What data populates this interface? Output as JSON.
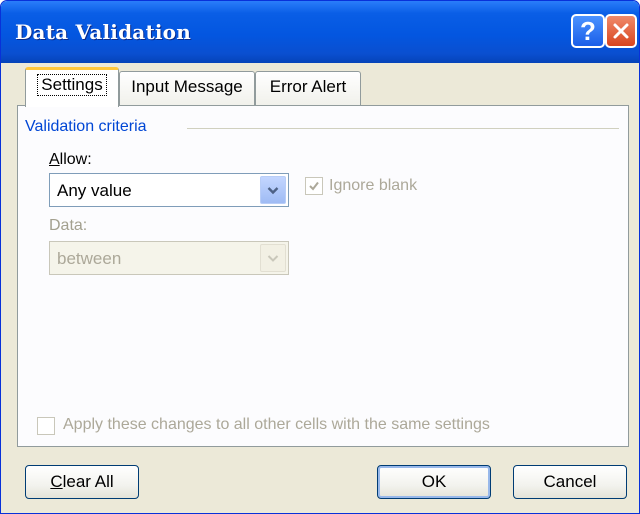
{
  "window": {
    "title": "Data Validation",
    "help_glyph": "?",
    "colors": {
      "titlebar": "#0a5ee6",
      "dialog_bg": "#ece9d8",
      "group_label": "#0046d5",
      "disabled_text": "#aca899"
    }
  },
  "tabs": [
    {
      "label": "Settings",
      "selected": true
    },
    {
      "label": "Input Message",
      "selected": false
    },
    {
      "label": "Error Alert",
      "selected": false
    }
  ],
  "settings": {
    "group_label": "Validation criteria",
    "allow": {
      "label_mnemonic": "A",
      "label_rest": "llow:",
      "value": "Any value",
      "enabled": true
    },
    "ignore_blank": {
      "label": "Ignore blank",
      "checked": true,
      "enabled": false
    },
    "data": {
      "label": "Data:",
      "value": "between",
      "enabled": false
    },
    "apply_all": {
      "label": "Apply these changes to all other cells with the same settings",
      "checked": false,
      "enabled": false
    }
  },
  "buttons": {
    "clear_mnemonic": "C",
    "clear_rest": "lear All",
    "ok": "OK",
    "cancel": "Cancel"
  }
}
